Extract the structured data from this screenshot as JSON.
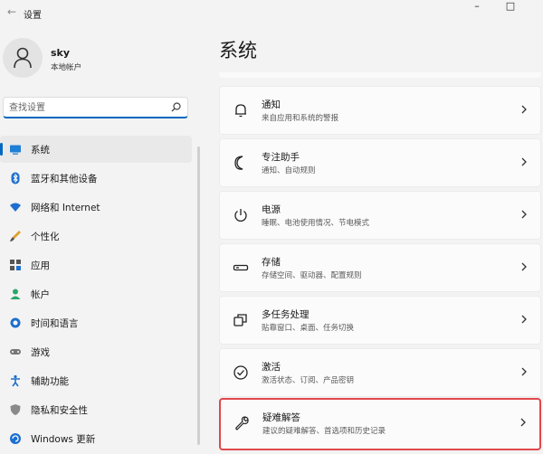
{
  "window": {
    "title": "设置",
    "back_glyph": "←",
    "minimize_glyph": "–",
    "maximize_glyph": "□"
  },
  "user": {
    "name": "sky",
    "account_type": "本地帐户"
  },
  "search": {
    "placeholder": "查找设置",
    "value": ""
  },
  "sidebar": {
    "items": [
      {
        "label": "系统",
        "icon": "monitor-icon",
        "active": true
      },
      {
        "label": "蓝牙和其他设备",
        "icon": "bluetooth-icon"
      },
      {
        "label": "网络和 Internet",
        "icon": "wifi-icon"
      },
      {
        "label": "个性化",
        "icon": "brush-icon"
      },
      {
        "label": "应用",
        "icon": "apps-icon"
      },
      {
        "label": "帐户",
        "icon": "person-icon"
      },
      {
        "label": "时间和语言",
        "icon": "globe-clock-icon"
      },
      {
        "label": "游戏",
        "icon": "gamepad-icon"
      },
      {
        "label": "辅助功能",
        "icon": "accessibility-icon"
      },
      {
        "label": "隐私和安全性",
        "icon": "shield-icon"
      },
      {
        "label": "Windows 更新",
        "icon": "update-icon"
      }
    ]
  },
  "main": {
    "title": "系统",
    "cards": [
      {
        "title": "通知",
        "subtitle": "来自应用和系统的警报",
        "icon": "bell-icon"
      },
      {
        "title": "专注助手",
        "subtitle": "通知、自动规则",
        "icon": "moon-icon"
      },
      {
        "title": "电源",
        "subtitle": "睡眠、电池使用情况、节电模式",
        "icon": "power-icon"
      },
      {
        "title": "存储",
        "subtitle": "存储空间、驱动器、配置规则",
        "icon": "storage-icon"
      },
      {
        "title": "多任务处理",
        "subtitle": "贴靠窗口、桌面、任务切换",
        "icon": "multitask-icon"
      },
      {
        "title": "激活",
        "subtitle": "激活状态、订阅、产品密钥",
        "icon": "check-circle-icon"
      },
      {
        "title": "疑难解答",
        "subtitle": "建议的疑难解答、首选项和历史记录",
        "icon": "wrench-icon",
        "highlighted": true
      }
    ]
  },
  "colors": {
    "accent": "#0067c0",
    "highlight_border": "#e0474c",
    "background": "#f3f3f3"
  }
}
